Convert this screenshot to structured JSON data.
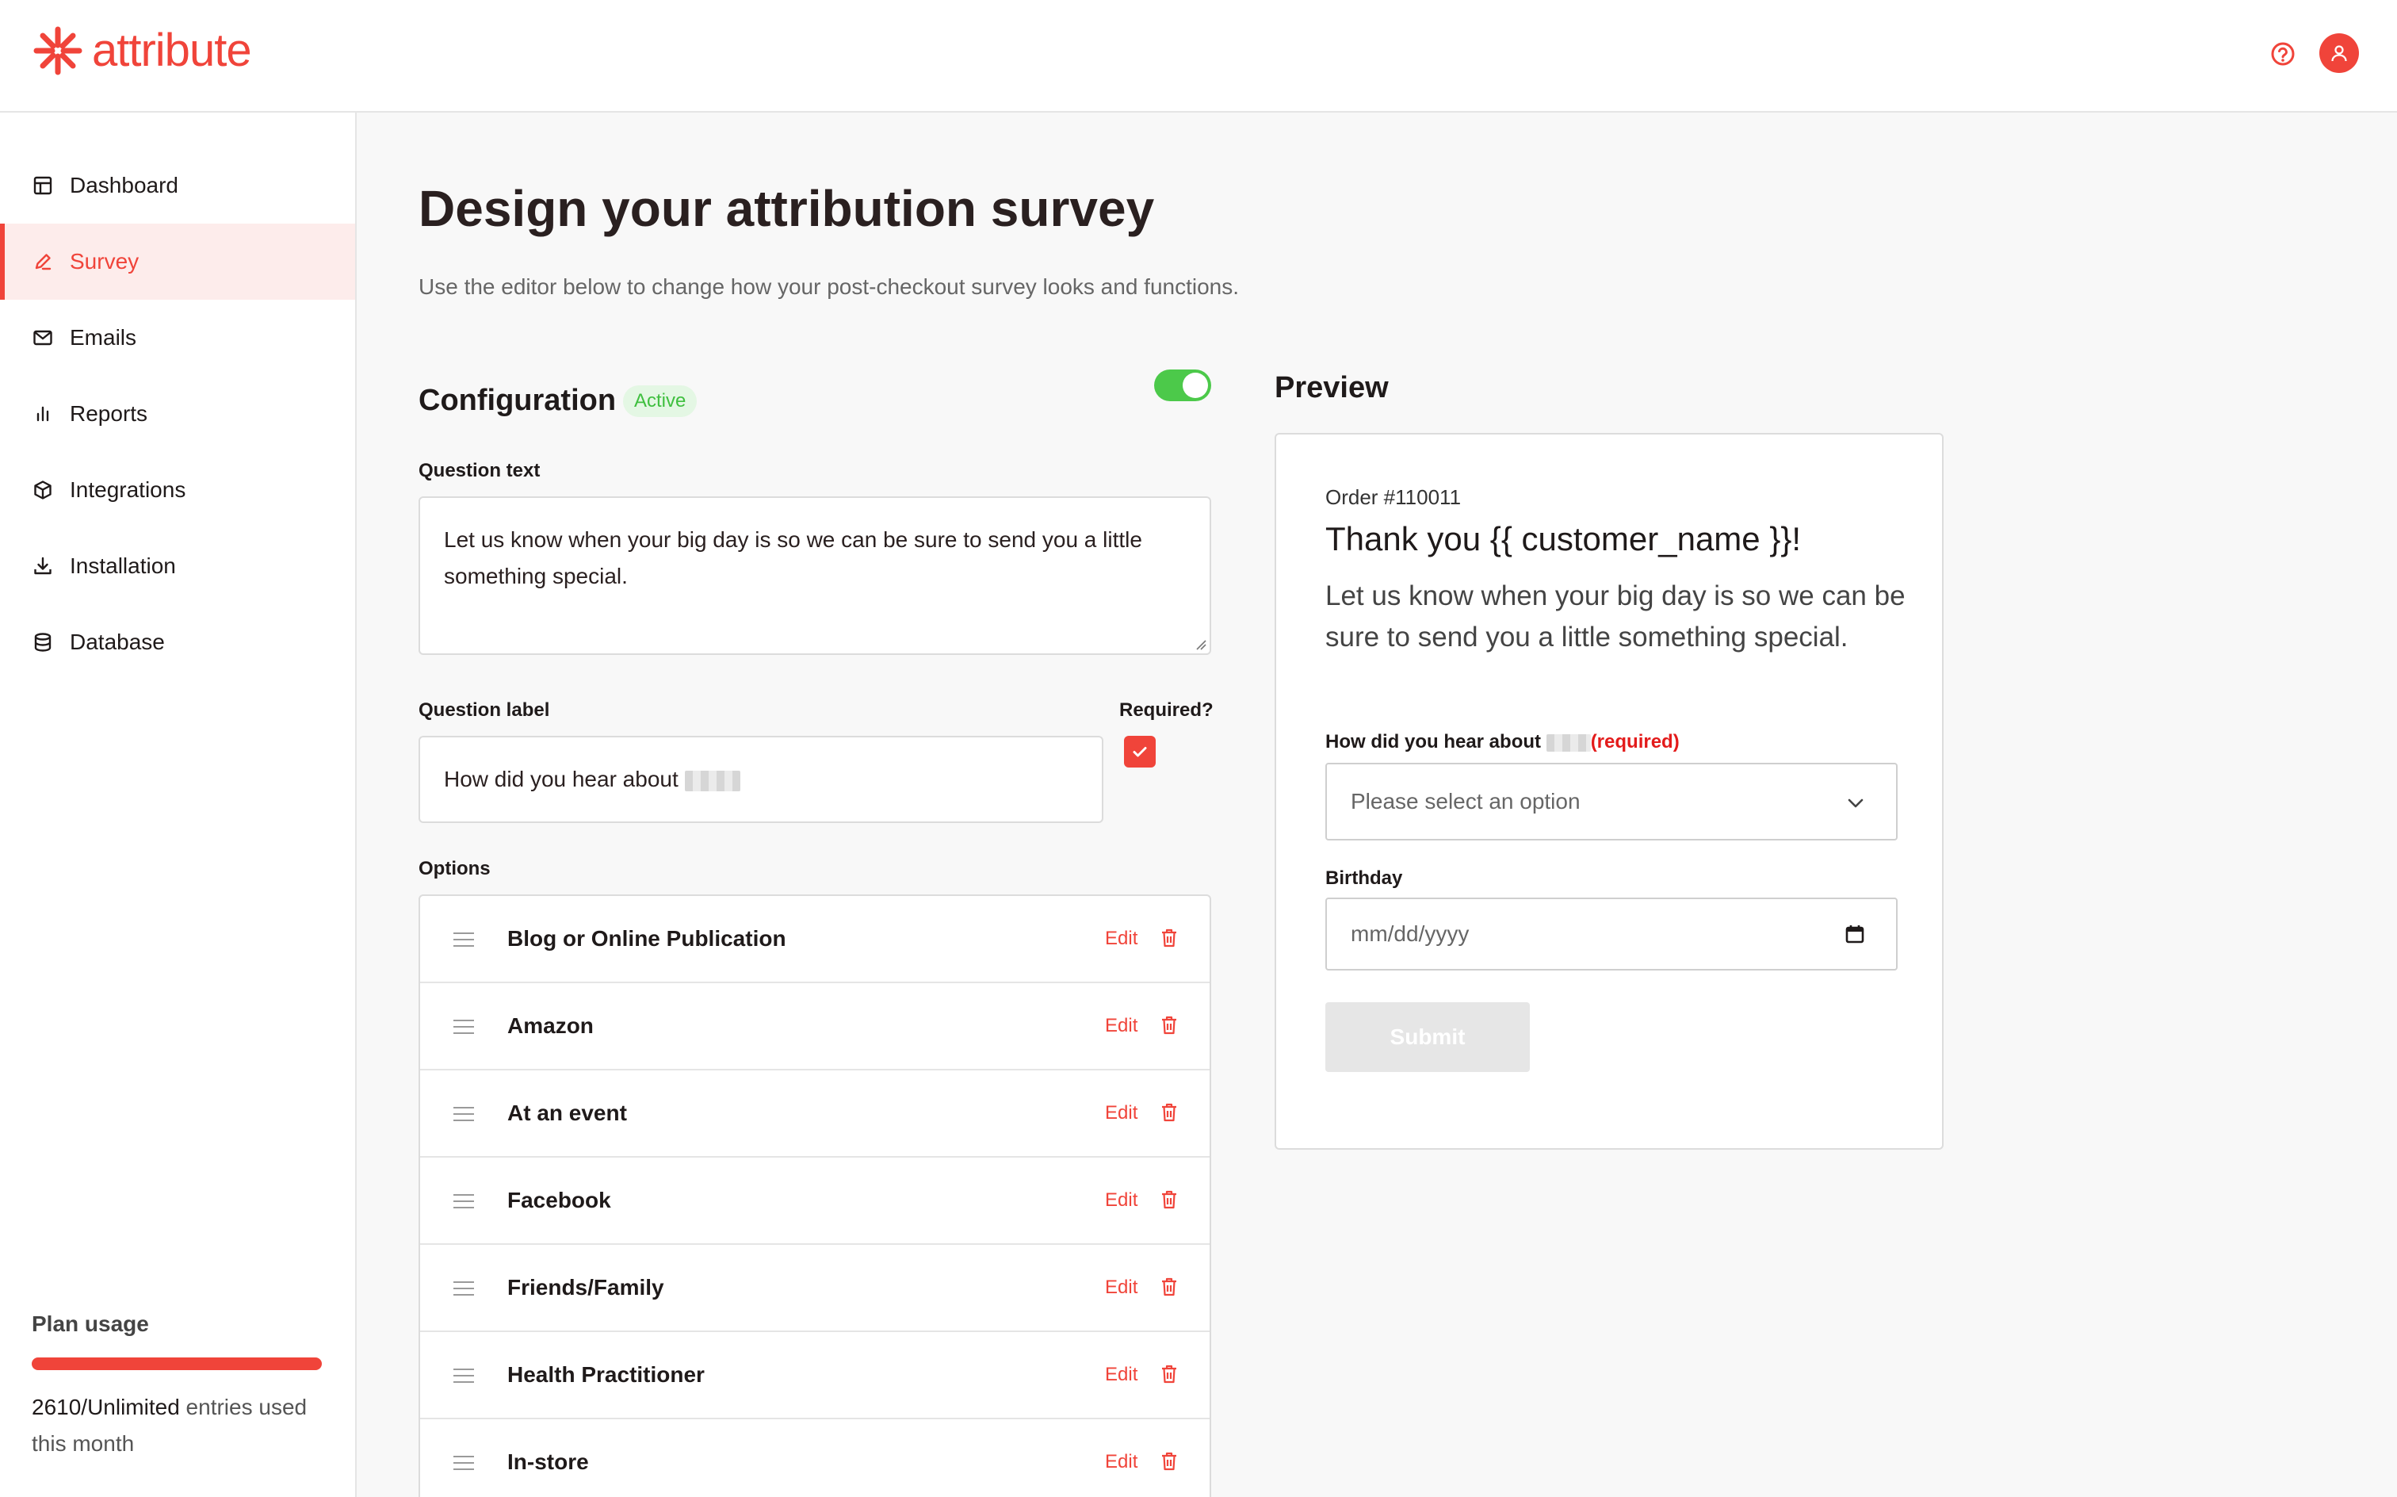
{
  "brand": {
    "name": "attribute",
    "accent": "#f0443a"
  },
  "header": {
    "help_icon": "help-circle-icon",
    "avatar_icon": "user-icon"
  },
  "sidebar": {
    "items": [
      {
        "label": "Dashboard",
        "icon": "layout-icon",
        "active": false
      },
      {
        "label": "Survey",
        "icon": "pencil-icon",
        "active": true
      },
      {
        "label": "Emails",
        "icon": "mail-icon",
        "active": false
      },
      {
        "label": "Reports",
        "icon": "bar-chart-icon",
        "active": false
      },
      {
        "label": "Integrations",
        "icon": "package-icon",
        "active": false
      },
      {
        "label": "Installation",
        "icon": "download-icon",
        "active": false
      },
      {
        "label": "Database",
        "icon": "database-icon",
        "active": false
      }
    ],
    "plan": {
      "title": "Plan usage",
      "count": "2610/Unlimited",
      "suffix": " entries used this month",
      "progress": 1.0
    }
  },
  "main": {
    "title": "Design your attribution survey",
    "subtitle": "Use the editor below to change how your post-checkout survey looks and functions.",
    "config": {
      "title": "Configuration",
      "status": "Active",
      "enabled": true,
      "question_text_label": "Question text",
      "question_text": "Let us know when your big day is so we can be sure to send you a little something special.",
      "question_label_label": "Question label",
      "question_label": "How did you hear about",
      "required_label": "Required?",
      "required": true,
      "options_label": "Options",
      "edit_label": "Edit",
      "options": [
        "Blog or Online Publication",
        "Amazon",
        "At an event",
        "Facebook",
        "Friends/Family",
        "Health Practitioner",
        "In-store"
      ]
    },
    "preview": {
      "title": "Preview",
      "order": "Order #110011",
      "thanks": "Thank you {{ customer_name }}!",
      "question": "Let us know when your big day is so we can be sure to send you a little something special.",
      "label": "How did you hear about",
      "required_tag": "(required)",
      "select_placeholder": "Please select an option",
      "birthday_label": "Birthday",
      "date_placeholder": "mm/dd/yyyy",
      "submit": "Submit"
    }
  }
}
